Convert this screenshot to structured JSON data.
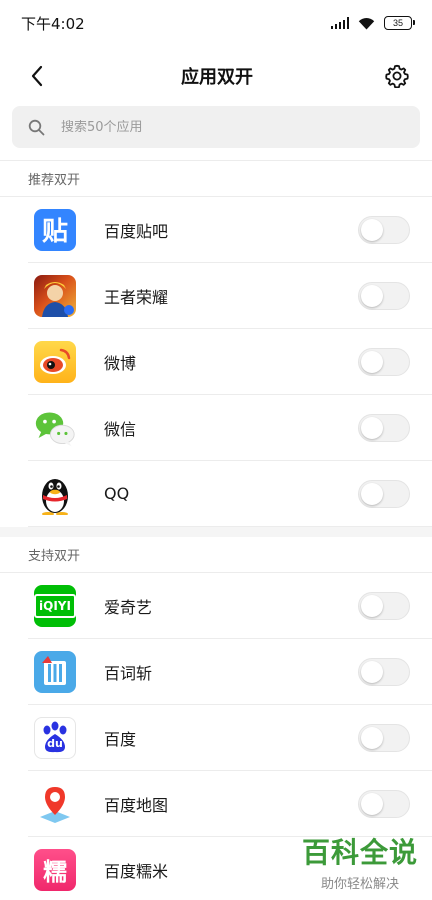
{
  "status_bar": {
    "time": "下午4:02",
    "battery": "35"
  },
  "header": {
    "title": "应用双开"
  },
  "search": {
    "placeholder": "搜索50个应用"
  },
  "sections": [
    {
      "title": "推荐双开",
      "apps": [
        {
          "name": "百度贴吧",
          "icon": "tieba-icon",
          "enabled": false
        },
        {
          "name": "王者荣耀",
          "icon": "honor-of-kings-icon",
          "enabled": false
        },
        {
          "name": "微博",
          "icon": "weibo-icon",
          "enabled": false
        },
        {
          "name": "微信",
          "icon": "wechat-icon",
          "enabled": false
        },
        {
          "name": "QQ",
          "icon": "qq-icon",
          "enabled": false
        }
      ]
    },
    {
      "title": "支持双开",
      "apps": [
        {
          "name": "爱奇艺",
          "icon": "iqiyi-icon",
          "enabled": false
        },
        {
          "name": "百词斩",
          "icon": "baicizhan-icon",
          "enabled": false
        },
        {
          "name": "百度",
          "icon": "baidu-icon",
          "enabled": false
        },
        {
          "name": "百度地图",
          "icon": "baidu-map-icon",
          "enabled": false
        },
        {
          "name": "百度糯米",
          "icon": "baidu-nuomi-icon",
          "enabled": false
        }
      ]
    }
  ],
  "icon_text": {
    "tieba": "贴",
    "iqiyi": "iQIYI",
    "baidu": "du",
    "nuomi": "糯"
  },
  "watermark": {
    "main": "百科全说",
    "sub": "助你轻松解决"
  },
  "colors": {
    "toggle_off": "#f2f2f2",
    "watermark": "#3c9a39",
    "tieba": "#3385ff",
    "iqiyi": "#00be06"
  }
}
